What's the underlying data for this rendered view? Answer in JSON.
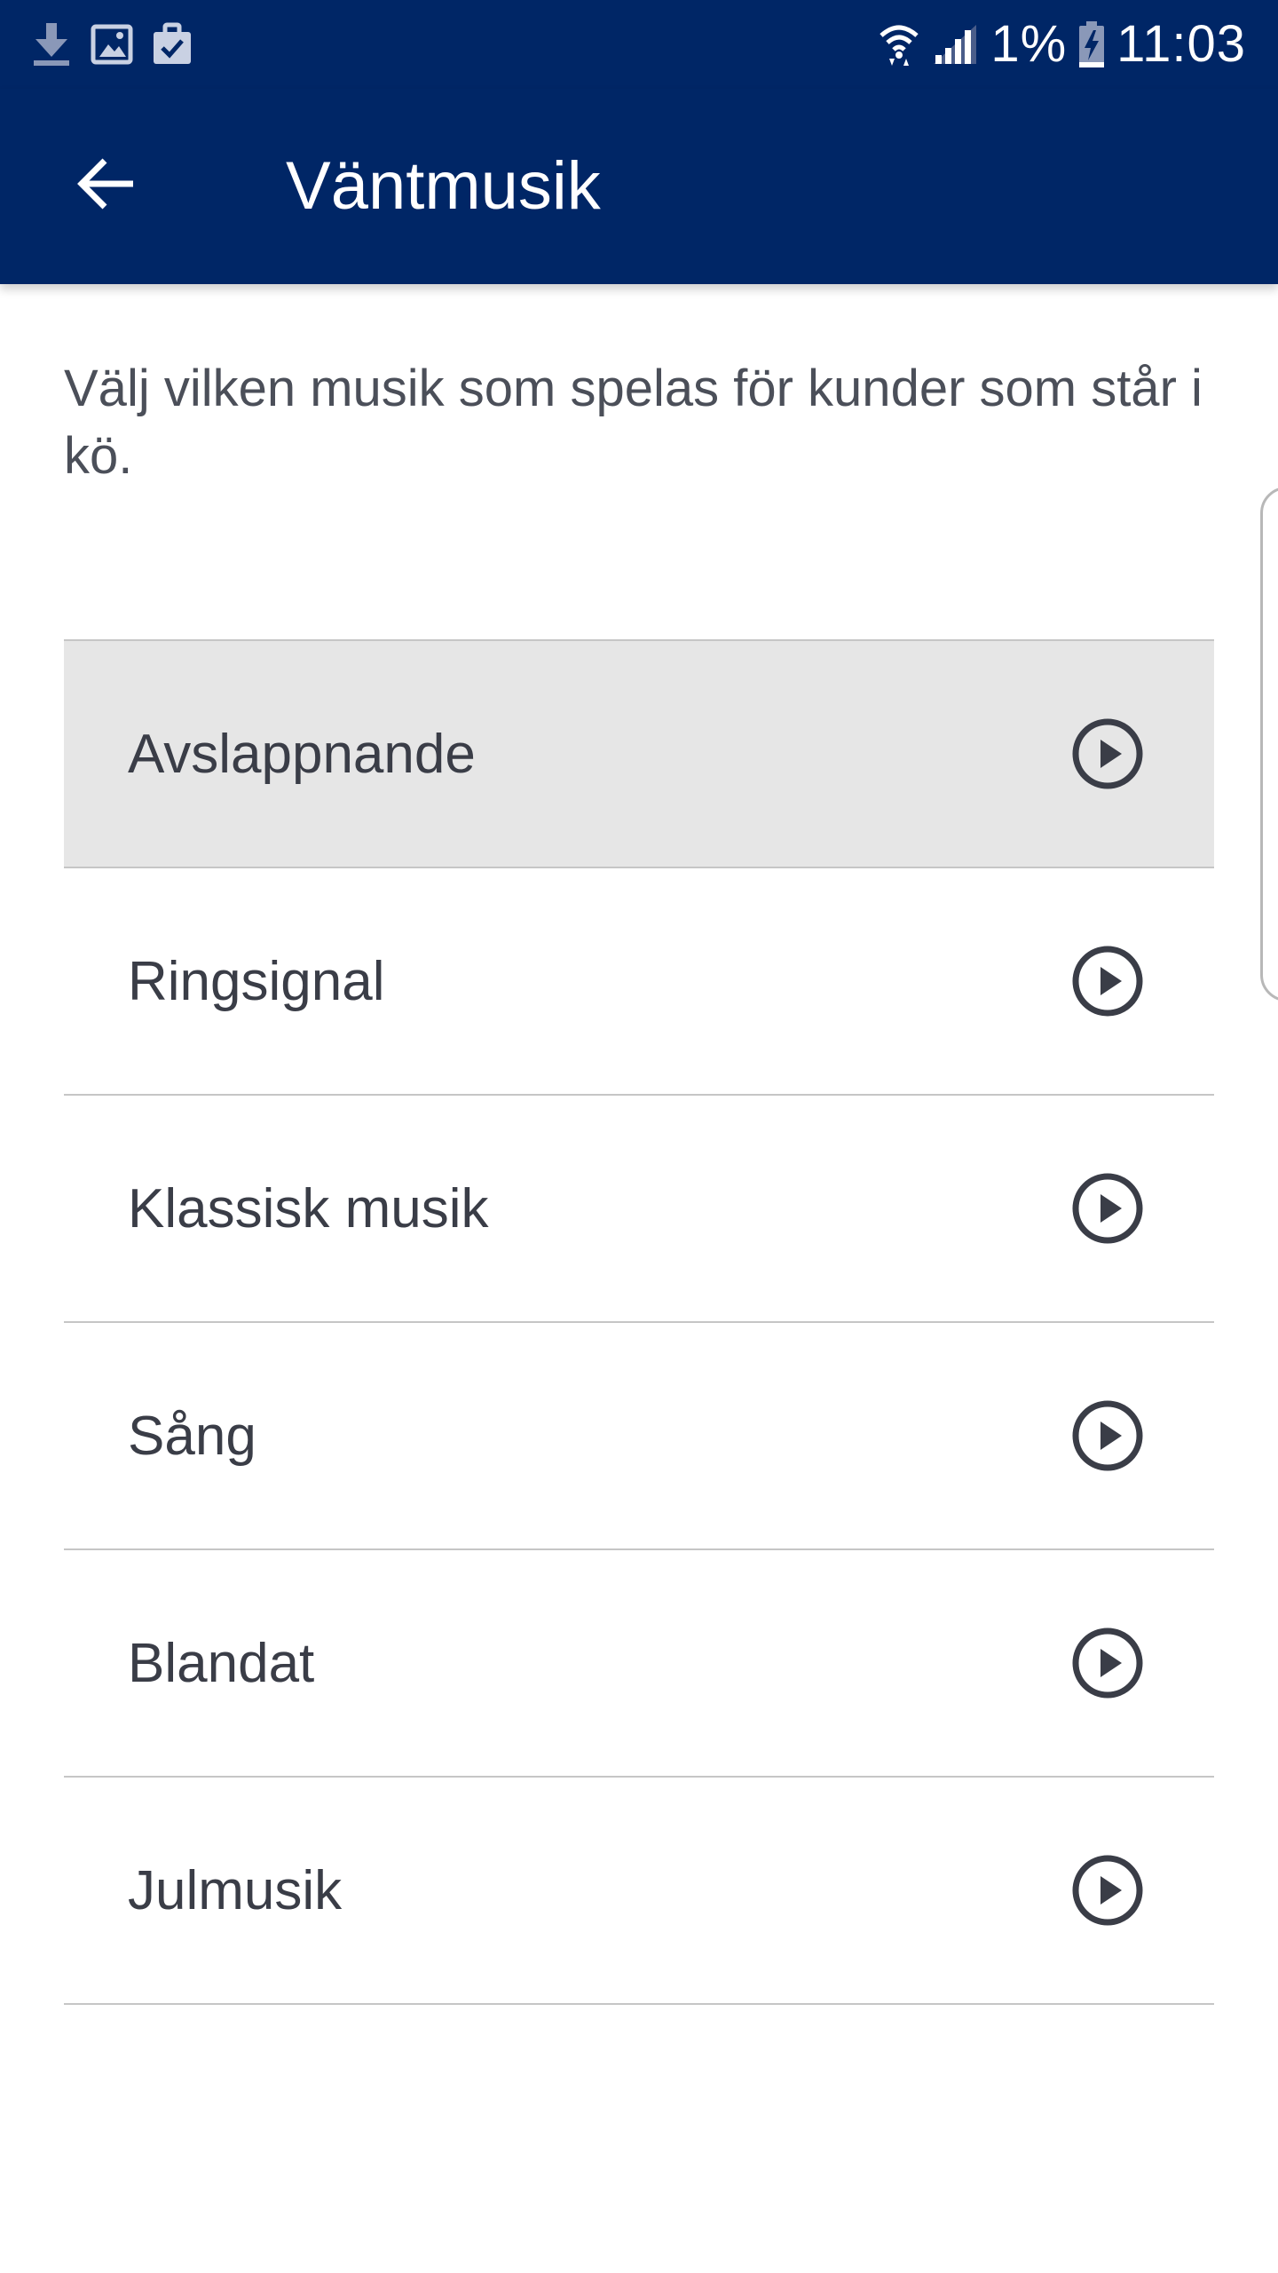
{
  "status_bar": {
    "left_icons": [
      "download-icon",
      "image-icon",
      "clipboard-check-icon"
    ],
    "right_icons": [
      "wifi-icon",
      "signal-icon",
      "battery-charging-icon"
    ],
    "battery_percent": "1%",
    "time": "11:03"
  },
  "app_bar": {
    "back_icon": "arrow-left-icon",
    "title": "Väntmusik"
  },
  "description": "Välj vilken musik som spelas för kunder som står i kö.",
  "music_list": {
    "selected_index": 0,
    "items": [
      {
        "label": "Avslappnande",
        "icon": "play-circle-icon"
      },
      {
        "label": "Ringsignal",
        "icon": "play-circle-icon"
      },
      {
        "label": "Klassisk musik",
        "icon": "play-circle-icon"
      },
      {
        "label": "Sång",
        "icon": "play-circle-icon"
      },
      {
        "label": "Blandat",
        "icon": "play-circle-icon"
      },
      {
        "label": "Julmusik",
        "icon": "play-circle-icon"
      }
    ]
  },
  "colors": {
    "header": "#002666",
    "selected_row": "#e6e6e6",
    "divider": "#c6c6c6",
    "text": "#3a3d47",
    "icon": "#3a3d47"
  }
}
